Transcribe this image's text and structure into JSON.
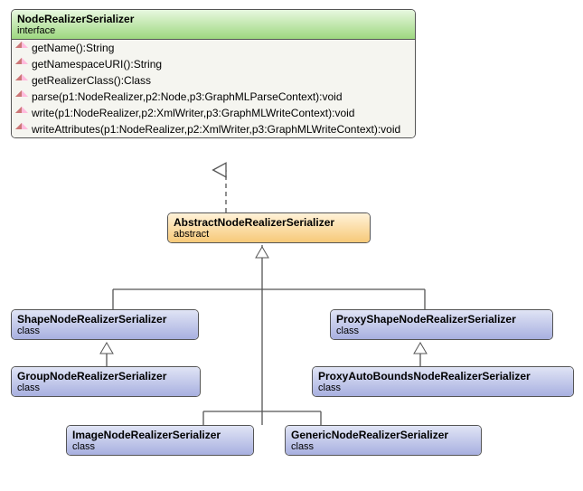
{
  "interface": {
    "name": "NodeRealizerSerializer",
    "stereotype": "interface",
    "methods": [
      "getName():String",
      "getNamespaceURI():String",
      "getRealizerClass():Class",
      "parse(p1:NodeRealizer,p2:Node,p3:GraphMLParseContext):void",
      "write(p1:NodeRealizer,p2:XmlWriter,p3:GraphMLWriteContext):void",
      "writeAttributes(p1:NodeRealizer,p2:XmlWriter,p3:GraphMLWriteContext):void"
    ]
  },
  "abstract": {
    "name": "AbstractNodeRealizerSerializer",
    "stereotype": "abstract"
  },
  "classes": {
    "shape": {
      "name": "ShapeNodeRealizerSerializer",
      "stereotype": "class"
    },
    "group": {
      "name": "GroupNodeRealizerSerializer",
      "stereotype": "class"
    },
    "image": {
      "name": "ImageNodeRealizerSerializer",
      "stereotype": "class"
    },
    "generic": {
      "name": "GenericNodeRealizerSerializer",
      "stereotype": "class"
    },
    "proxy": {
      "name": "ProxyShapeNodeRealizerSerializer",
      "stereotype": "class"
    },
    "proxyauto": {
      "name": "ProxyAutoBoundsNodeRealizerSerializer",
      "stereotype": "class"
    }
  }
}
